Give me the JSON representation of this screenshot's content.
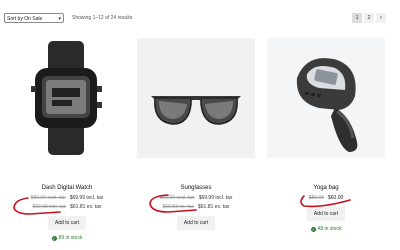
{
  "toolbar": {
    "sort_value": "Sort by On Sale",
    "result_count": "Showing 1–12 of 24 results",
    "pages": [
      "1",
      "2"
    ],
    "next_icon": "chevron-right-icon"
  },
  "products": [
    {
      "title": "Dash Digital Watch",
      "prices": [
        {
          "old": "$80.00 excl. tax",
          "new": "$69.99 incl. tax"
        },
        {
          "old": "$69.99 incl. tax",
          "new": "$61.81 ex. tax"
        }
      ],
      "button": "Add to cart",
      "stock": "89 in stock"
    },
    {
      "title": "Sunglasses",
      "prices": [
        {
          "old": "$80.00 excl. tax",
          "new": "$69.99 incl. tax"
        },
        {
          "old": "$69.83 ex. tax",
          "new": "$61.81 ex. tax"
        }
      ],
      "button": "Add to cart"
    },
    {
      "title": "Yoga bag",
      "prices": [
        {
          "old": "$80.00",
          "new": "$60.00"
        }
      ],
      "button": "Add to cart",
      "stock": "48 in stock"
    }
  ],
  "colors": {
    "annotation": "#c8101e",
    "stock": "#2e7d32"
  }
}
